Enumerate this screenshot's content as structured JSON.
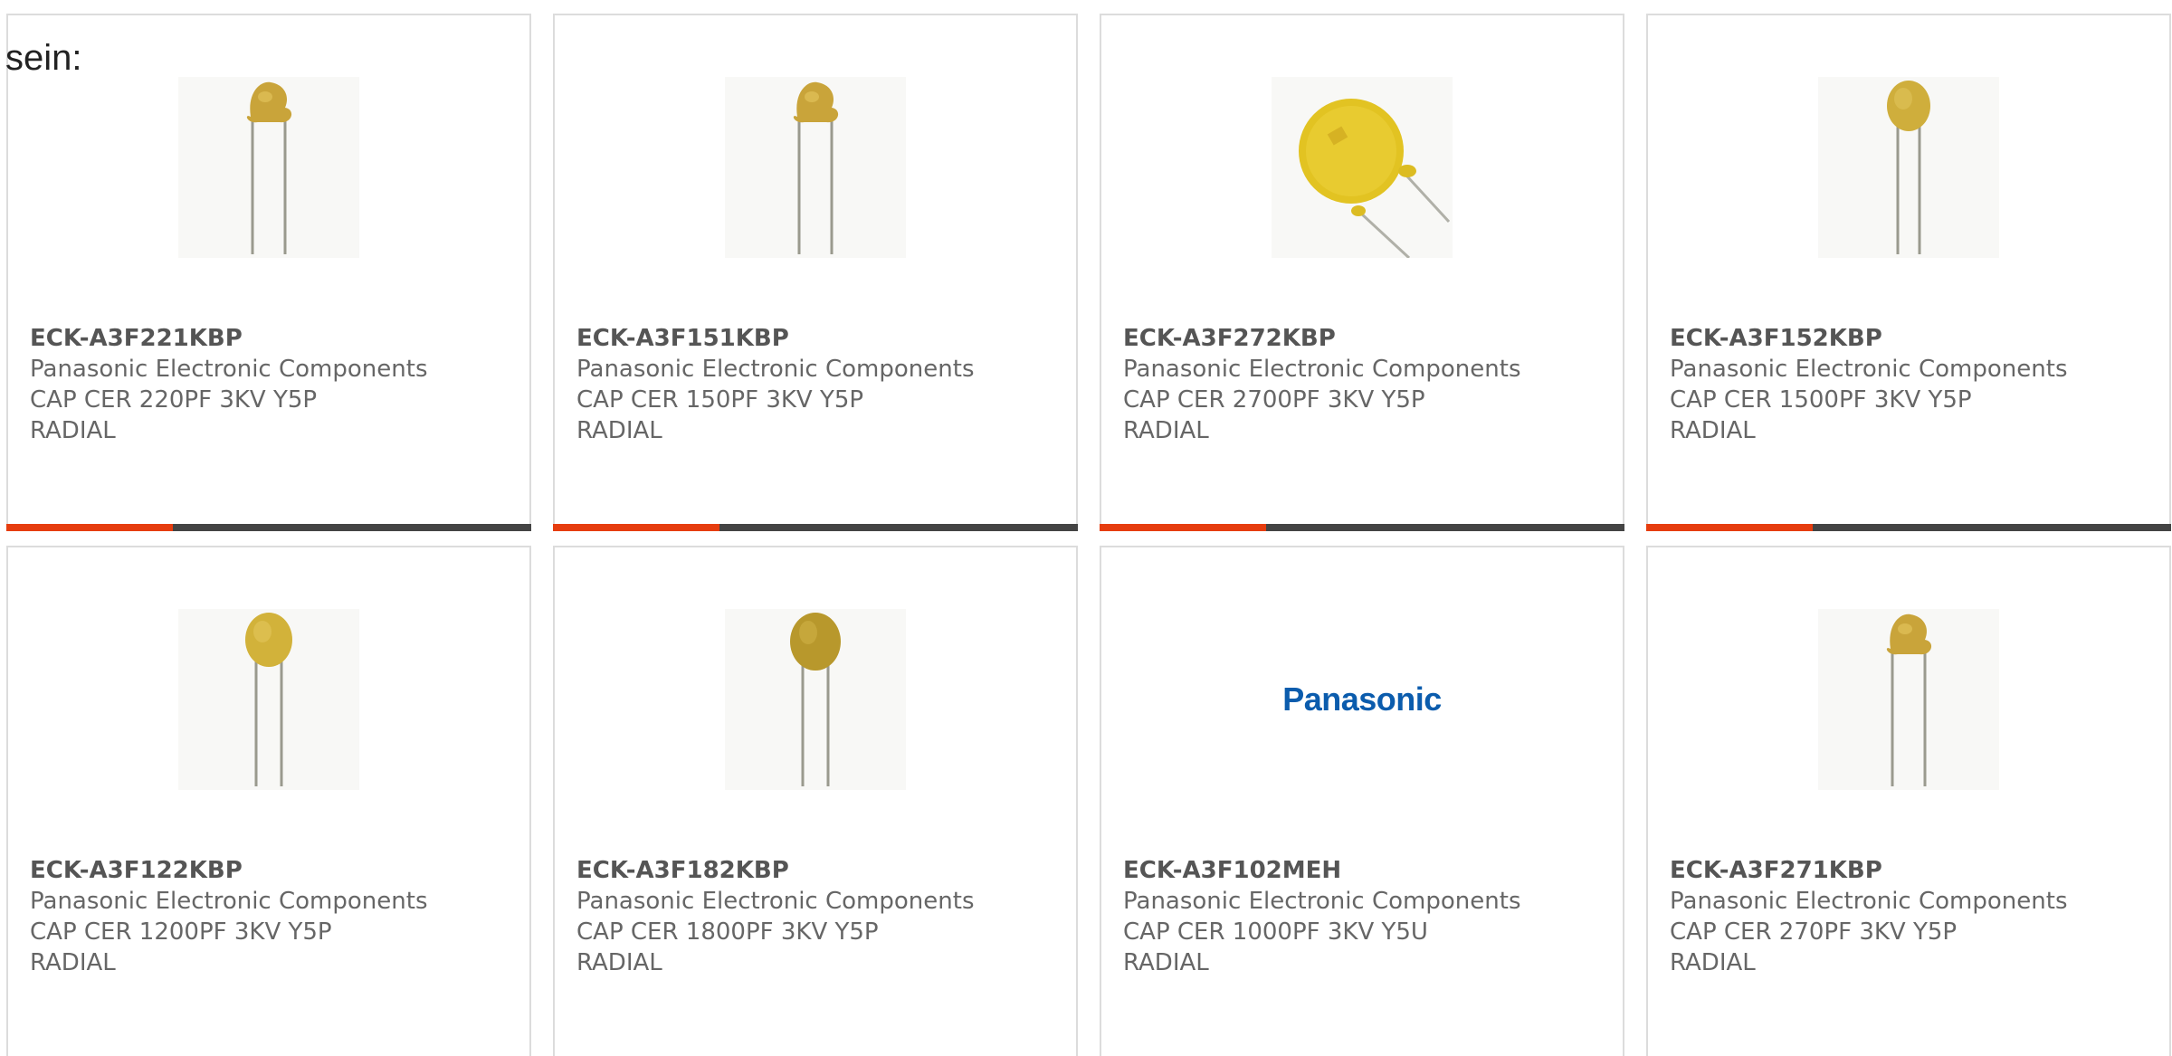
{
  "lead_text": "sein:",
  "colors": {
    "accent": "#e63d0f",
    "bar": "#444444",
    "border": "#dcdcdc",
    "capacitor_yellow": "#d4b23a",
    "panasonic_blue": "#0b5cad"
  },
  "products": [
    {
      "part": "ECK-A3F221KBP",
      "manufacturer": "Panasonic Electronic Components",
      "description": "CAP CER 220PF 3KV Y5P RADIAL",
      "image": "small-disc-capacitor"
    },
    {
      "part": "ECK-A3F151KBP",
      "manufacturer": "Panasonic Electronic Components",
      "description": "CAP CER 150PF 3KV Y5P RADIAL",
      "image": "small-disc-capacitor"
    },
    {
      "part": "ECK-A3F272KBP",
      "manufacturer": "Panasonic Electronic Components",
      "description": "CAP CER 2700PF 3KV Y5P RADIAL",
      "image": "large-disc-capacitor"
    },
    {
      "part": "ECK-A3F152KBP",
      "manufacturer": "Panasonic Electronic Components",
      "description": "CAP CER 1500PF 3KV Y5P RADIAL",
      "image": "medium-disc-capacitor"
    },
    {
      "part": "ECK-A3F122KBP",
      "manufacturer": "Panasonic Electronic Components",
      "description": "CAP CER 1200PF 3KV Y5P RADIAL",
      "image": "medium-disc-capacitor"
    },
    {
      "part": "ECK-A3F182KBP",
      "manufacturer": "Panasonic Electronic Components",
      "description": "CAP CER 1800PF 3KV Y5P RADIAL",
      "image": "medium-disc-capacitor-dark"
    },
    {
      "part": "ECK-A3F102MEH",
      "manufacturer": "Panasonic Electronic Components",
      "description": "CAP CER 1000PF 3KV Y5U RADIAL",
      "image": "panasonic-logo",
      "logo_text": "Panasonic"
    },
    {
      "part": "ECK-A3F271KBP",
      "manufacturer": "Panasonic Electronic Components",
      "description": "CAP CER 270PF 3KV Y5P RADIAL",
      "image": "small-disc-capacitor"
    }
  ]
}
